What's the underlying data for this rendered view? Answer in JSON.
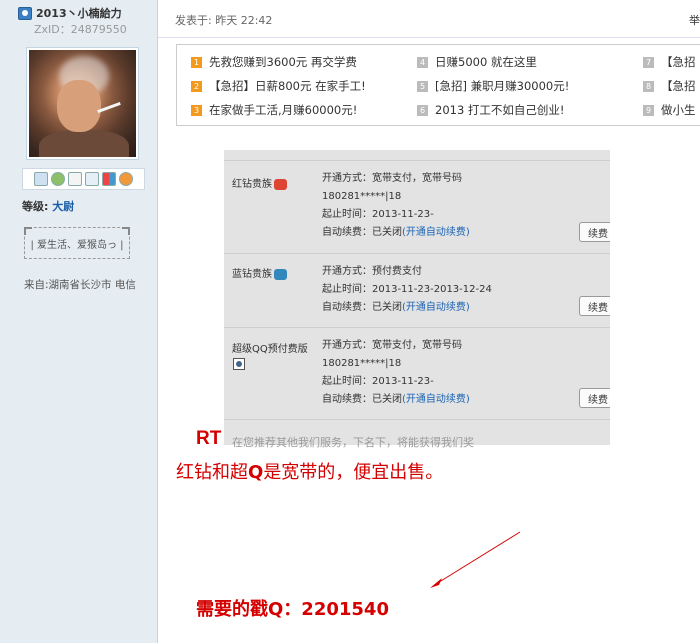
{
  "user": {
    "name": "2013丶小楠給力",
    "zxid": "ZxID：24879550",
    "level_label": "等级:",
    "level_value": "大尉",
    "signature": "| 爱生活、爱猴岛っ |",
    "location": "来自:湖南省长沙市 电信",
    "icons": [
      "mail-icon",
      "user-icon",
      "doc-icon",
      "card-icon",
      "blocks-icon",
      "person-icon"
    ]
  },
  "post": {
    "time": "发表于: 昨天 22:42",
    "floor": "举"
  },
  "ads": [
    {
      "num": "1",
      "hot": true,
      "text": "先救您赚到3600元 再交学费"
    },
    {
      "num": "2",
      "hot": true,
      "text": "【急招】日薪800元 在家手工!"
    },
    {
      "num": "3",
      "hot": true,
      "text": "在家做手工活,月赚60000元!"
    },
    {
      "num": "4",
      "hot": false,
      "text": "日赚5000 就在这里"
    },
    {
      "num": "5",
      "hot": false,
      "text": "[急招] 兼职月赚30000元!"
    },
    {
      "num": "6",
      "hot": false,
      "text": "2013 打工不如自己创业!"
    },
    {
      "num": "7",
      "hot": false,
      "text": "【急招"
    },
    {
      "num": "8",
      "hot": false,
      "text": "【急招"
    },
    {
      "num": "9",
      "hot": false,
      "text": "做小生"
    }
  ],
  "services": [
    {
      "name": "红钻贵族",
      "lines": [
        "开通方式：宽带支付，宽带号码",
        "180281*****|18",
        "起止时间：2013-11-23-"
      ],
      "renew_prefix": "自动续费：已关闭",
      "renew_link": "(开通自动续费)",
      "button": "续费"
    },
    {
      "name": "蓝钻贵族",
      "lines": [
        "开通方式：预付费支付",
        "起止时间：2013-11-23-2013-12-24"
      ],
      "renew_prefix": "自动续费：已关闭",
      "renew_link": "(开通自动续费)",
      "button": "续费"
    },
    {
      "name": "超级QQ预付费版",
      "lines": [
        "开通方式：宽带支付，宽带号码",
        "180281*****|18",
        "起止时间：2013-11-23-"
      ],
      "renew_prefix": "自动续费：已关闭",
      "renew_link": "(开通自动续费)",
      "button": "续费"
    }
  ],
  "content": {
    "rt": "RT",
    "cut_text": "在您推荐其他我们服务，下名下，将能获得我们奖",
    "line1_a": "红钻和超",
    "line1_q": "Q",
    "line1_b": "是宽带的，便宜出售。",
    "line2": "需要的戳Q：2201540"
  },
  "colors": {
    "accent_red": "#d40000",
    "sidebar_bg": "#e5edf2",
    "link_blue": "#1b64b3",
    "ad_hot": "#f39a1e"
  }
}
